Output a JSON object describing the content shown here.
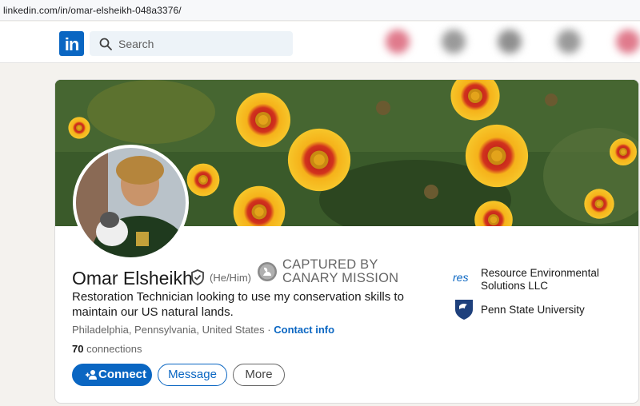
{
  "browser": {
    "url": "linkedin.com/in/omar-elsheikh-048a3376/"
  },
  "nav": {
    "logo_text": "in",
    "search_placeholder": "Search",
    "brand_color": "#0a66c2"
  },
  "profile": {
    "name": "Omar Elsheikh",
    "pronouns": "(He/Him)",
    "overlay_line1": "CAPTURED BY",
    "overlay_line2": "CANARY MISSION",
    "headline": "Restoration Technician looking to use my conservation skills to maintain our US natural lands.",
    "location": "Philadelphia, Pennsylvania, United States",
    "separator": "·",
    "contact_info_label": "Contact info",
    "connections_count": "70",
    "connections_label": "connections"
  },
  "actions": {
    "connect_label": "Connect",
    "message_label": "Message",
    "more_label": "More"
  },
  "organizations": [
    {
      "logo_text": "res",
      "name_line1": "Resource Environmental",
      "name_line2": "Solutions LLC"
    },
    {
      "name_line1": "Penn State University"
    }
  ]
}
